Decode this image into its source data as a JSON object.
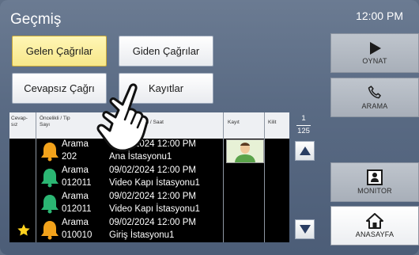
{
  "screen": {
    "title": "Geçmiş",
    "time": "12:00 PM"
  },
  "tabs": {
    "incoming": "Gelen Çağrılar",
    "outgoing": "Giden Çağrılar",
    "missed": "Cevapsız Çağrı",
    "recordings": "Kayıtlar"
  },
  "table": {
    "headers": {
      "missed": "Cevap-\nsız",
      "priority": "Öncelikli / Tip\nSayı",
      "date": "Tarih / Saat",
      "record": "Kayıt",
      "lock": "Kilit"
    },
    "rows": [
      {
        "type": "Arama",
        "number": "202",
        "datetime": "09/02/2024 12:00 PM",
        "station": "Ana İstasyonu1",
        "bell_color": "#f2a21b",
        "starred": false,
        "has_thumb": true
      },
      {
        "type": "Arama",
        "number": "012011",
        "datetime": "09/02/2024 12:00 PM",
        "station": "Video Kapı İstasyonu1",
        "bell_color": "#2bb673",
        "starred": false,
        "has_thumb": false
      },
      {
        "type": "Arama",
        "number": "012011",
        "datetime": "09/02/2024 12:00 PM",
        "station": "Video Kapı İstasyonu1",
        "bell_color": "#2bb673",
        "starred": false,
        "has_thumb": false
      },
      {
        "type": "Arama",
        "number": "010010",
        "datetime": "09/02/2024 12:00 PM",
        "station": "Giriş İstasyonu1",
        "bell_color": "#f2a21b",
        "starred": true,
        "has_thumb": false
      }
    ]
  },
  "pager": {
    "current": "1",
    "total": "125"
  },
  "side": {
    "play": "OYNAT",
    "call": "ARAMA",
    "monitor": "MONITOR",
    "home": "ANASAYFA"
  },
  "colors": {
    "active_tab": "#f7e78a",
    "star": "#ffd21f"
  }
}
